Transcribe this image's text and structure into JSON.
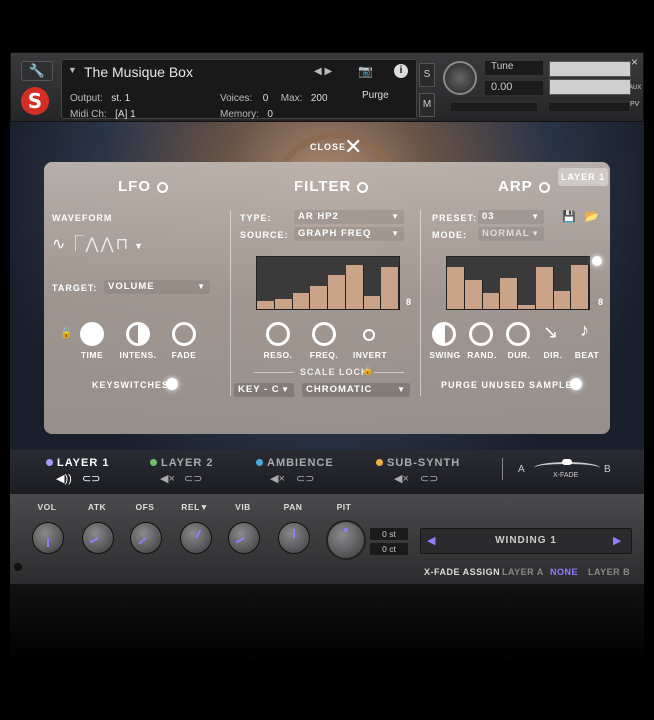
{
  "header": {
    "instrument_name": "The Musique Box",
    "output_label": "Output:",
    "output_value": "st. 1",
    "midi_label": "Midi Ch:",
    "midi_value": "[A] 1",
    "voices_label": "Voices:",
    "voices_value": "0",
    "max_label": "Max:",
    "max_value": "200",
    "memory_label": "Memory:",
    "memory_value": "0",
    "purge_label": "Purge",
    "s_button": "S",
    "m_button": "M",
    "tune_label": "Tune",
    "tune_value": "0.00",
    "aux_label": "AUX",
    "pv_label": "PV",
    "close_glyph": "×"
  },
  "panel": {
    "close_label": "CLOSE",
    "layer_badge": "LAYER 1",
    "lfo": {
      "title": "LFO",
      "waveform_label": "WAVEFORM",
      "target_label": "TARGET:",
      "target_value": "VOLUME",
      "knobs": [
        "TIME",
        "INTENS.",
        "FADE"
      ],
      "keyswitches_label": "KEYSWITCHES"
    },
    "filter": {
      "title": "FILTER",
      "type_label": "TYPE:",
      "type_value": "AR HP2",
      "source_label": "SOURCE:",
      "source_value": "GRAPH FREQ",
      "graph_steps": "8",
      "graph_values": [
        0.15,
        0.2,
        0.3,
        0.45,
        0.65,
        0.85,
        0.25,
        0.8
      ],
      "knobs": [
        "RESO.",
        "FREQ.",
        "INVERT"
      ],
      "scale_lock_label": "SCALE LOCK",
      "key_value": "KEY - C",
      "scale_value": "CHROMATIC"
    },
    "arp": {
      "title": "ARP",
      "preset_label": "PRESET:",
      "preset_value": "03",
      "mode_label": "MODE:",
      "mode_value": "NORMAL",
      "graph_steps": "8",
      "graph_values": [
        0.8,
        0.55,
        0.3,
        0.6,
        0.08,
        0.8,
        0.35,
        0.85
      ],
      "knobs": [
        "SWING",
        "RAND.",
        "DUR.",
        "DIR.",
        "BEAT"
      ],
      "purge_label": "PURGE UNUSED SAMPLES"
    }
  },
  "layers": [
    {
      "label": "LAYER 1",
      "color": "#a89bff"
    },
    {
      "label": "LAYER 2",
      "color": "#6fc06a"
    },
    {
      "label": "AMBIENCE",
      "color": "#4aa9e0"
    },
    {
      "label": "SUB-SYNTH",
      "color": "#f0b040"
    }
  ],
  "xfade": {
    "a": "A",
    "b": "B",
    "label": "X-FADE"
  },
  "bottom": {
    "knobs": [
      "VOL",
      "ATK",
      "OFS",
      "REL▼",
      "VIB",
      "PAN",
      "PIT"
    ],
    "pitch_st": "0 st",
    "pitch_ct": "0 ct",
    "preset_name": "WINDING 1",
    "xfade_assign_label": "X-FADE ASSIGN",
    "xfade_options": [
      "LAYER A",
      "NONE",
      "LAYER B"
    ],
    "xfade_selected": "NONE"
  },
  "colors": {
    "accent": "#8f7dff",
    "logo": "#d42d24",
    "bar": "#c9a488"
  }
}
